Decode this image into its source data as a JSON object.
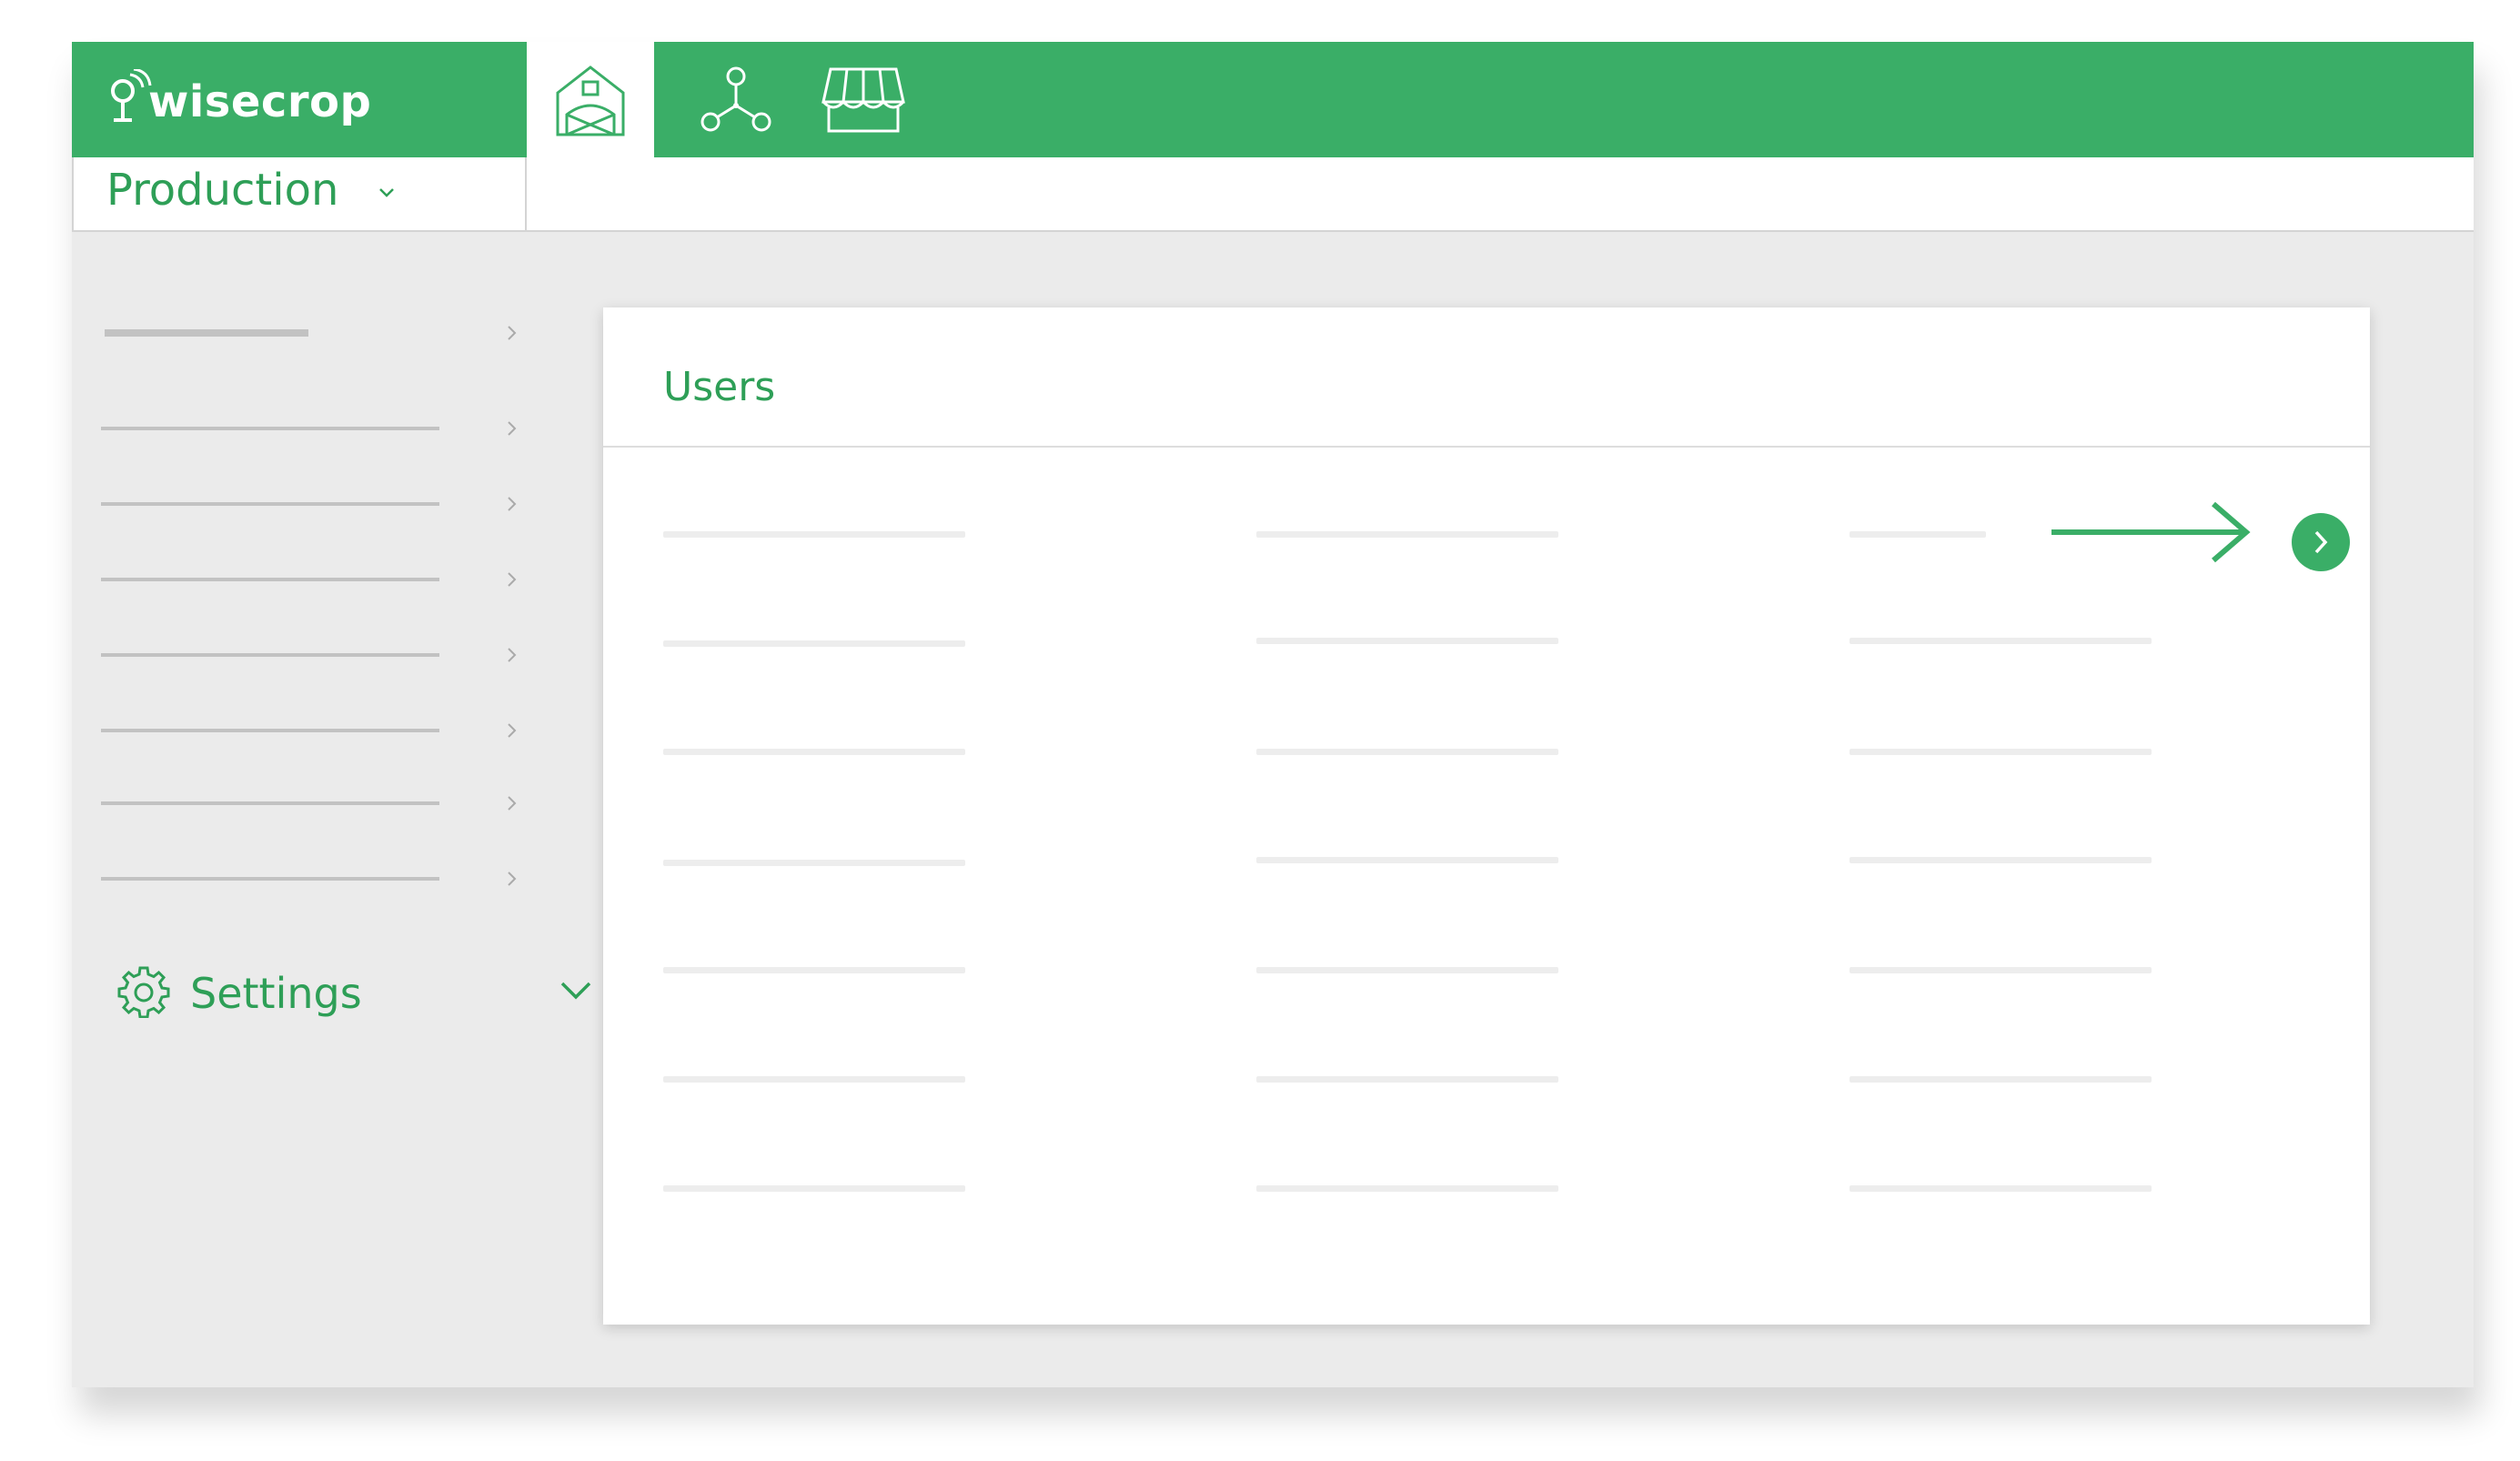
{
  "app": {
    "brand": "wisecrop",
    "nav_tabs": [
      {
        "icon": "farm-barn-icon",
        "active": true
      },
      {
        "icon": "network-nodes-icon",
        "active": false
      },
      {
        "icon": "market-stall-icon",
        "active": false
      }
    ]
  },
  "production_selector": {
    "label": "Production",
    "icon": "chevron-down-icon"
  },
  "sidebar": {
    "items_count": 8,
    "settings": {
      "label": "Settings",
      "icon": "gear-icon",
      "expand_icon": "chevron-down-icon"
    }
  },
  "users_panel": {
    "title": "Users",
    "rows": 7,
    "columns": 3,
    "highlighted_row_action_icon": "chevron-right-icon"
  },
  "colors": {
    "brand_green": "#3aae67",
    "text_green": "#2e9f57",
    "background": "#ebebeb",
    "placeholder": "#ededed"
  }
}
